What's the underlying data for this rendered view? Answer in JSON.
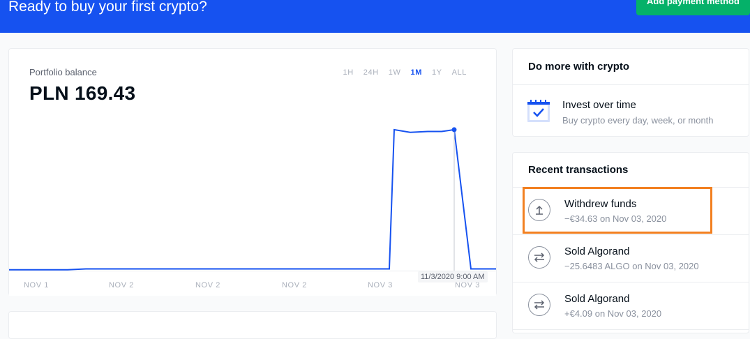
{
  "banner": {
    "title": "Ready to buy your first crypto?",
    "button_label": "Add payment method"
  },
  "portfolio": {
    "label": "Portfolio balance",
    "value": "PLN 169.43",
    "ranges": [
      "1H",
      "24H",
      "1W",
      "1M",
      "1Y",
      "ALL"
    ],
    "active_range": "1M",
    "tooltip": "11/3/2020 9:00 AM"
  },
  "chart_data": {
    "type": "line",
    "x_tick_labels": [
      "NOV 1",
      "NOV 2",
      "NOV 2",
      "NOV 2",
      "NOV 3",
      "NOV 3"
    ],
    "series": [
      {
        "values": [
          1,
          1,
          1,
          2,
          2,
          2,
          2,
          2,
          2,
          2,
          2,
          2,
          2,
          2,
          2,
          158,
          155,
          156,
          156,
          158,
          2,
          2,
          2
        ]
      }
    ],
    "ylim": [
      0,
      190
    ],
    "line_color": "#1652f0",
    "highlighted_index": 19
  },
  "do_more": {
    "title": "Do more with crypto",
    "invest_title": "Invest over time",
    "invest_sub": "Buy crypto every day, week, or month"
  },
  "recent": {
    "title": "Recent transactions",
    "items": [
      {
        "title": "Withdrew funds",
        "sub": "−€34.63 on Nov 03, 2020",
        "icon": "withdraw-arrow-up-icon"
      },
      {
        "title": "Sold Algorand",
        "sub": "−25.6483 ALGO on Nov 03, 2020",
        "icon": "swap-arrows-icon"
      },
      {
        "title": "Sold Algorand",
        "sub": "+€4.09 on Nov 03, 2020",
        "icon": "swap-arrows-icon"
      }
    ]
  },
  "colors": {
    "brand_blue": "#1652f0",
    "highlight_orange": "#f28021",
    "button_green": "#05b169"
  }
}
